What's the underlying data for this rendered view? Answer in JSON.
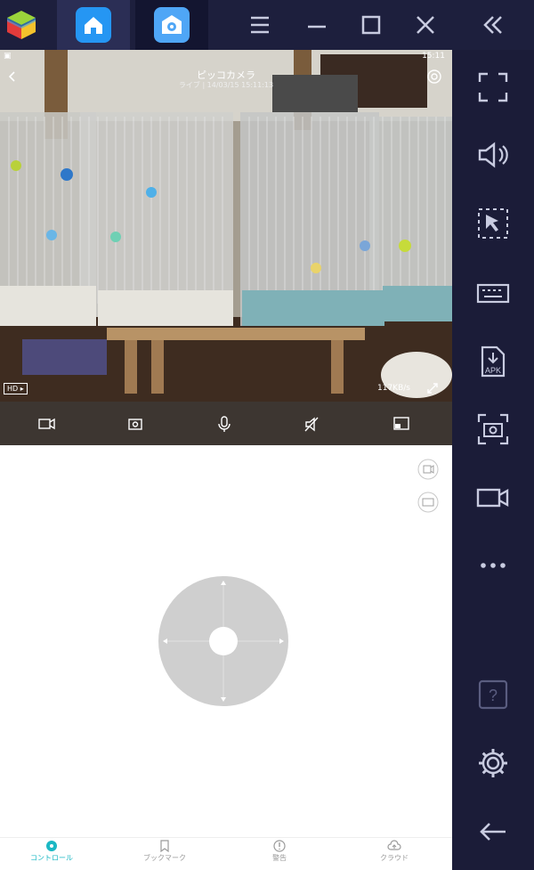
{
  "app": {
    "window_controls": [
      "menu-icon",
      "minimize-icon",
      "maximize-icon",
      "close-icon"
    ],
    "collapse": "double-chevron-left-icon"
  },
  "phone": {
    "status_time": "15:11",
    "camera_name": "ピッコカメラ",
    "live_label": "ライブ | 14/03/15 15:11:13",
    "quality_badge": "HD",
    "bitrate": "117KB/s",
    "controls": [
      "video-record-icon",
      "screenshot-icon",
      "microphone-icon",
      "mute-icon",
      "picture-in-picture-icon"
    ],
    "side_icons": [
      "replay-icon",
      "fullscreen-icon"
    ],
    "bottom_nav": [
      {
        "label": "コントロール",
        "icon": "joystick-icon",
        "active": true
      },
      {
        "label": "ブックマーク",
        "icon": "bookmark-icon",
        "active": false
      },
      {
        "label": "警告",
        "icon": "alert-icon",
        "active": false
      },
      {
        "label": "クラウド",
        "icon": "cloud-icon",
        "active": false
      }
    ]
  },
  "sidebar": {
    "icons": [
      "fullscreen-icon",
      "volume-icon",
      "pointer-icon",
      "keyboard-icon",
      "apk-install-icon",
      "screenshot-icon",
      "record-icon",
      "more-icon",
      "help-icon",
      "settings-icon",
      "back-icon"
    ],
    "apk_label": "APK",
    "help_label": "?"
  },
  "colors": {
    "accent": "#2596f3",
    "active_nav": "#1bb8c4",
    "sidebar_bg": "#1b1c38"
  }
}
